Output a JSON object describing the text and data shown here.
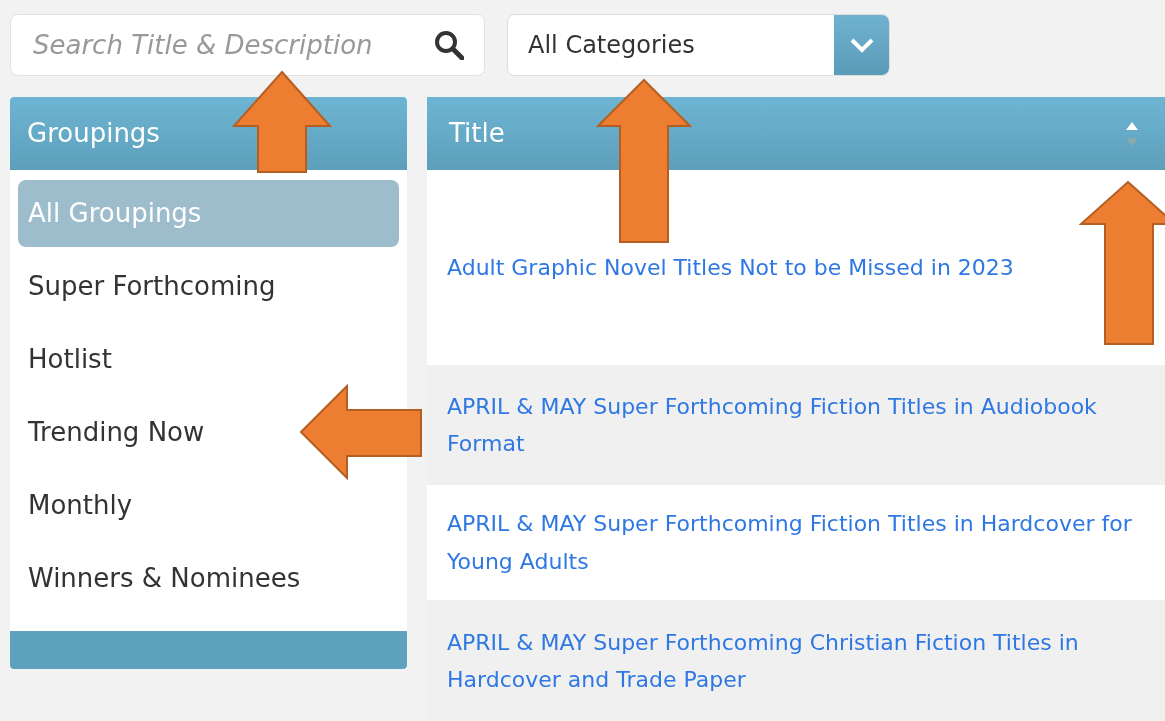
{
  "search": {
    "placeholder": "Search Title & Description"
  },
  "category_select": {
    "value": "All Categories"
  },
  "groupings": {
    "title": "Groupings",
    "items": [
      {
        "label": "All Groupings",
        "selected": true
      },
      {
        "label": "Super Forthcoming",
        "selected": false
      },
      {
        "label": "Hotlist",
        "selected": false
      },
      {
        "label": "Trending Now",
        "selected": false
      },
      {
        "label": "Monthly",
        "selected": false
      },
      {
        "label": "Winners & Nominees",
        "selected": false
      }
    ]
  },
  "table": {
    "columns": [
      "Title"
    ],
    "rows": [
      {
        "title": "Adult Graphic Novel Titles Not to be Missed in 2023"
      },
      {
        "title": "APRIL & MAY Super Forthcoming Fiction Titles in Audiobook Format"
      },
      {
        "title": "APRIL & MAY Super Forthcoming Fiction Titles in Hardcover for Young Adults"
      },
      {
        "title": "APRIL & MAY Super Forthcoming Christian Fiction Titles in Hardcover and Trade Paper"
      }
    ]
  }
}
